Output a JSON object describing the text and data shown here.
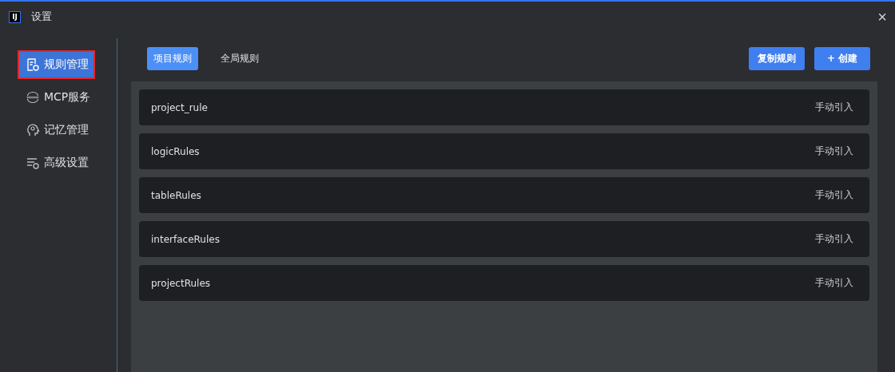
{
  "window": {
    "logo": "IJ",
    "title": "设置",
    "close": "×"
  },
  "sidebar": {
    "items": [
      {
        "label": "规则管理",
        "selected": true
      },
      {
        "label": "MCP服务",
        "selected": false
      },
      {
        "label": "记忆管理",
        "selected": false
      },
      {
        "label": "高级设置",
        "selected": false
      }
    ]
  },
  "tabs": [
    {
      "label": "项目规则",
      "selected": true
    },
    {
      "label": "全局规则",
      "selected": false
    }
  ],
  "actions": [
    "复制规则",
    "+ 创建"
  ],
  "rules": [
    {
      "name": "project_rule",
      "mode": "手动引入"
    },
    {
      "name": "logicRules",
      "mode": "手动引入"
    },
    {
      "name": "tableRules",
      "mode": "手动引入"
    },
    {
      "name": "interfaceRules",
      "mode": "手动引入"
    },
    {
      "name": "projectRules",
      "mode": "手动引入"
    }
  ]
}
